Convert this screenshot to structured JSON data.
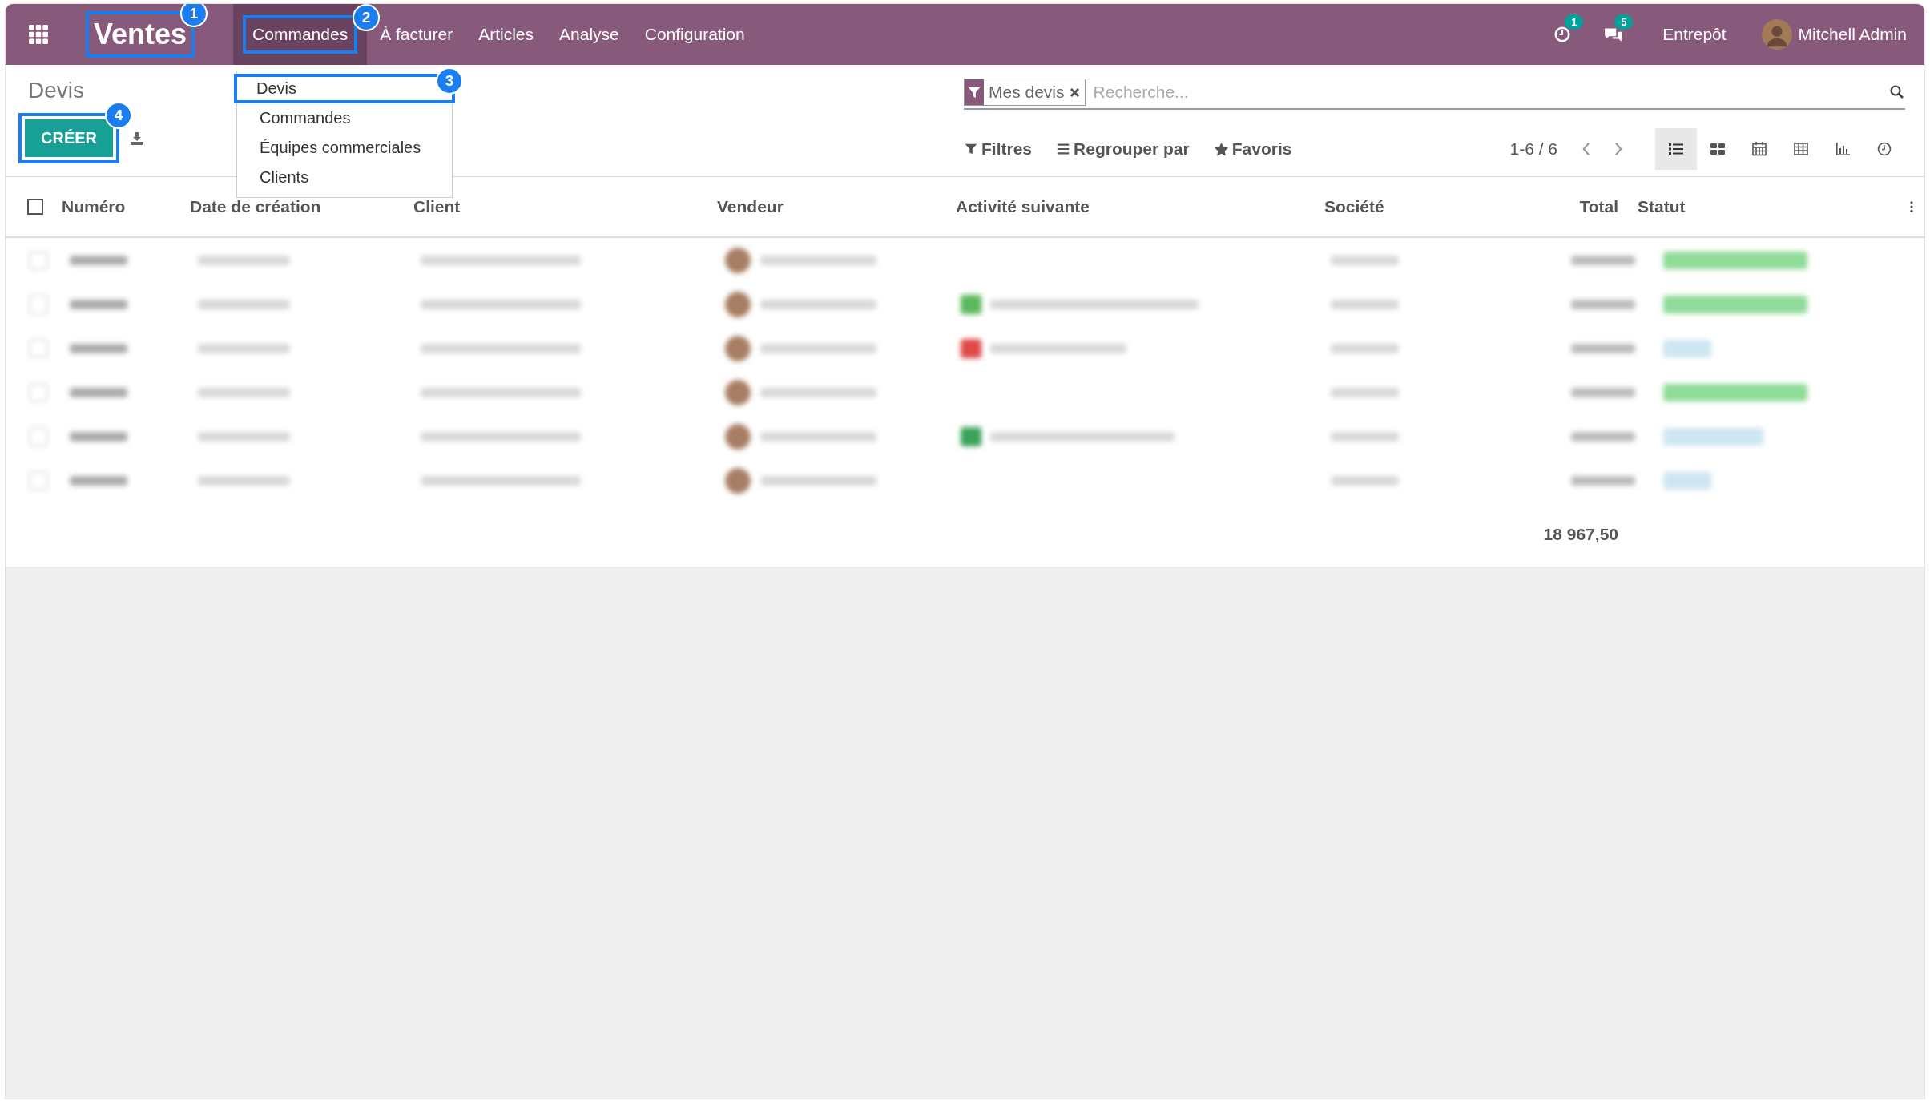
{
  "navbar": {
    "app_name": {
      "text": "Ventes",
      "callout": "1"
    },
    "menu": [
      {
        "label": "Commandes",
        "selected": true,
        "callout": "2"
      },
      {
        "label": "À facturer",
        "selected": false
      },
      {
        "label": "Articles",
        "selected": false
      },
      {
        "label": "Analyse",
        "selected": false
      },
      {
        "label": "Configuration",
        "selected": false
      }
    ],
    "activity_count": "1",
    "message_count": "5",
    "company": "Entrepôt",
    "user": "Mitchell Admin"
  },
  "dropdown": {
    "items": [
      {
        "label": "Devis",
        "callout": "3"
      },
      {
        "label": "Commandes"
      },
      {
        "label": "Équipes commerciales"
      },
      {
        "label": "Clients"
      }
    ]
  },
  "control_panel": {
    "title": "Devis",
    "create_button": {
      "label": "CRÉER",
      "callout": "4"
    },
    "search": {
      "facet": "Mes devis",
      "placeholder": "Recherche..."
    },
    "options": [
      {
        "label": "Filtres",
        "kind": "filter"
      },
      {
        "label": "Regrouper par",
        "kind": "group"
      },
      {
        "label": "Favoris",
        "kind": "star"
      }
    ],
    "pager": "1-6 / 6",
    "views": [
      {
        "kind": "list",
        "selected": true
      },
      {
        "kind": "kanban",
        "selected": false
      },
      {
        "kind": "calendar",
        "selected": false
      },
      {
        "kind": "pivot",
        "selected": false
      },
      {
        "kind": "graph",
        "selected": false
      },
      {
        "kind": "activity",
        "selected": false
      }
    ]
  },
  "table": {
    "columns": [
      "Numéro",
      "Date de création",
      "Client",
      "Vendeur",
      "Activité suivante",
      "Société",
      "Total",
      "Statut"
    ],
    "select_all": {
      "checked": false
    },
    "total": "18 967,50"
  }
}
